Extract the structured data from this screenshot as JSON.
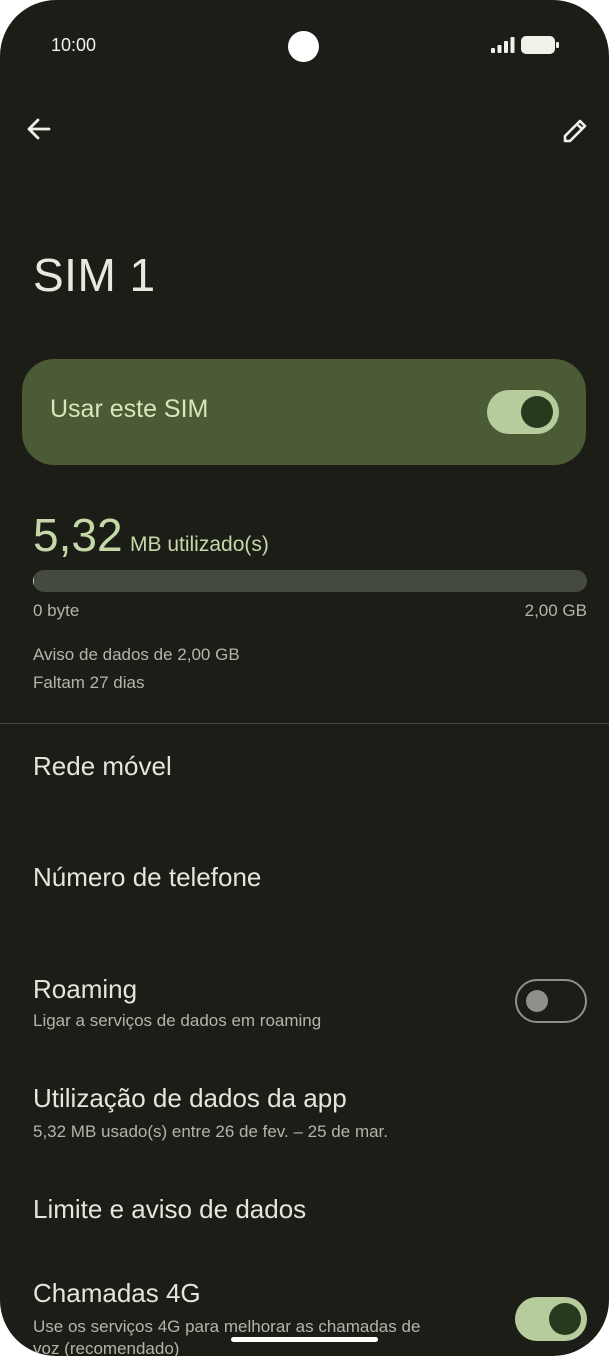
{
  "status_bar": {
    "time": "10:00"
  },
  "header": {
    "title": "SIM 1"
  },
  "use_sim": {
    "label": "Usar este SIM",
    "enabled": true
  },
  "usage": {
    "value": "5,32",
    "unit": "MB utilizado(s)",
    "fraction_used": 0.0026,
    "min_label": "0 byte",
    "max_label": "2,00 GB",
    "warning": "Aviso de dados de 2,00 GB",
    "days_left": "Faltam 27 dias"
  },
  "rows": {
    "mobile_network": {
      "title": "Rede móvel"
    },
    "phone_number": {
      "title": "Número de telefone"
    },
    "roaming": {
      "title": "Roaming",
      "subtitle": "Ligar a serviços de dados em roaming",
      "enabled": false
    },
    "app_data_usage": {
      "title": "Utilização de dados da app",
      "subtitle": "5,32 MB usado(s) entre 26 de fev. – 25 de mar."
    },
    "data_limit": {
      "title": "Limite e aviso de dados"
    },
    "calls_4g": {
      "title": "Chamadas 4G",
      "subtitle_line1": "Use os serviços 4G para melhorar as chamadas de",
      "subtitle_line2": "voz (recomendado)",
      "enabled": true
    }
  },
  "colors": {
    "background": "#1c1d17",
    "card": "#4a5b36",
    "accent": "#b7cc9c"
  },
  "icons": {
    "back": "arrow-left-icon",
    "edit": "pencil-icon",
    "signal": "signal-icon",
    "battery": "battery-icon"
  }
}
